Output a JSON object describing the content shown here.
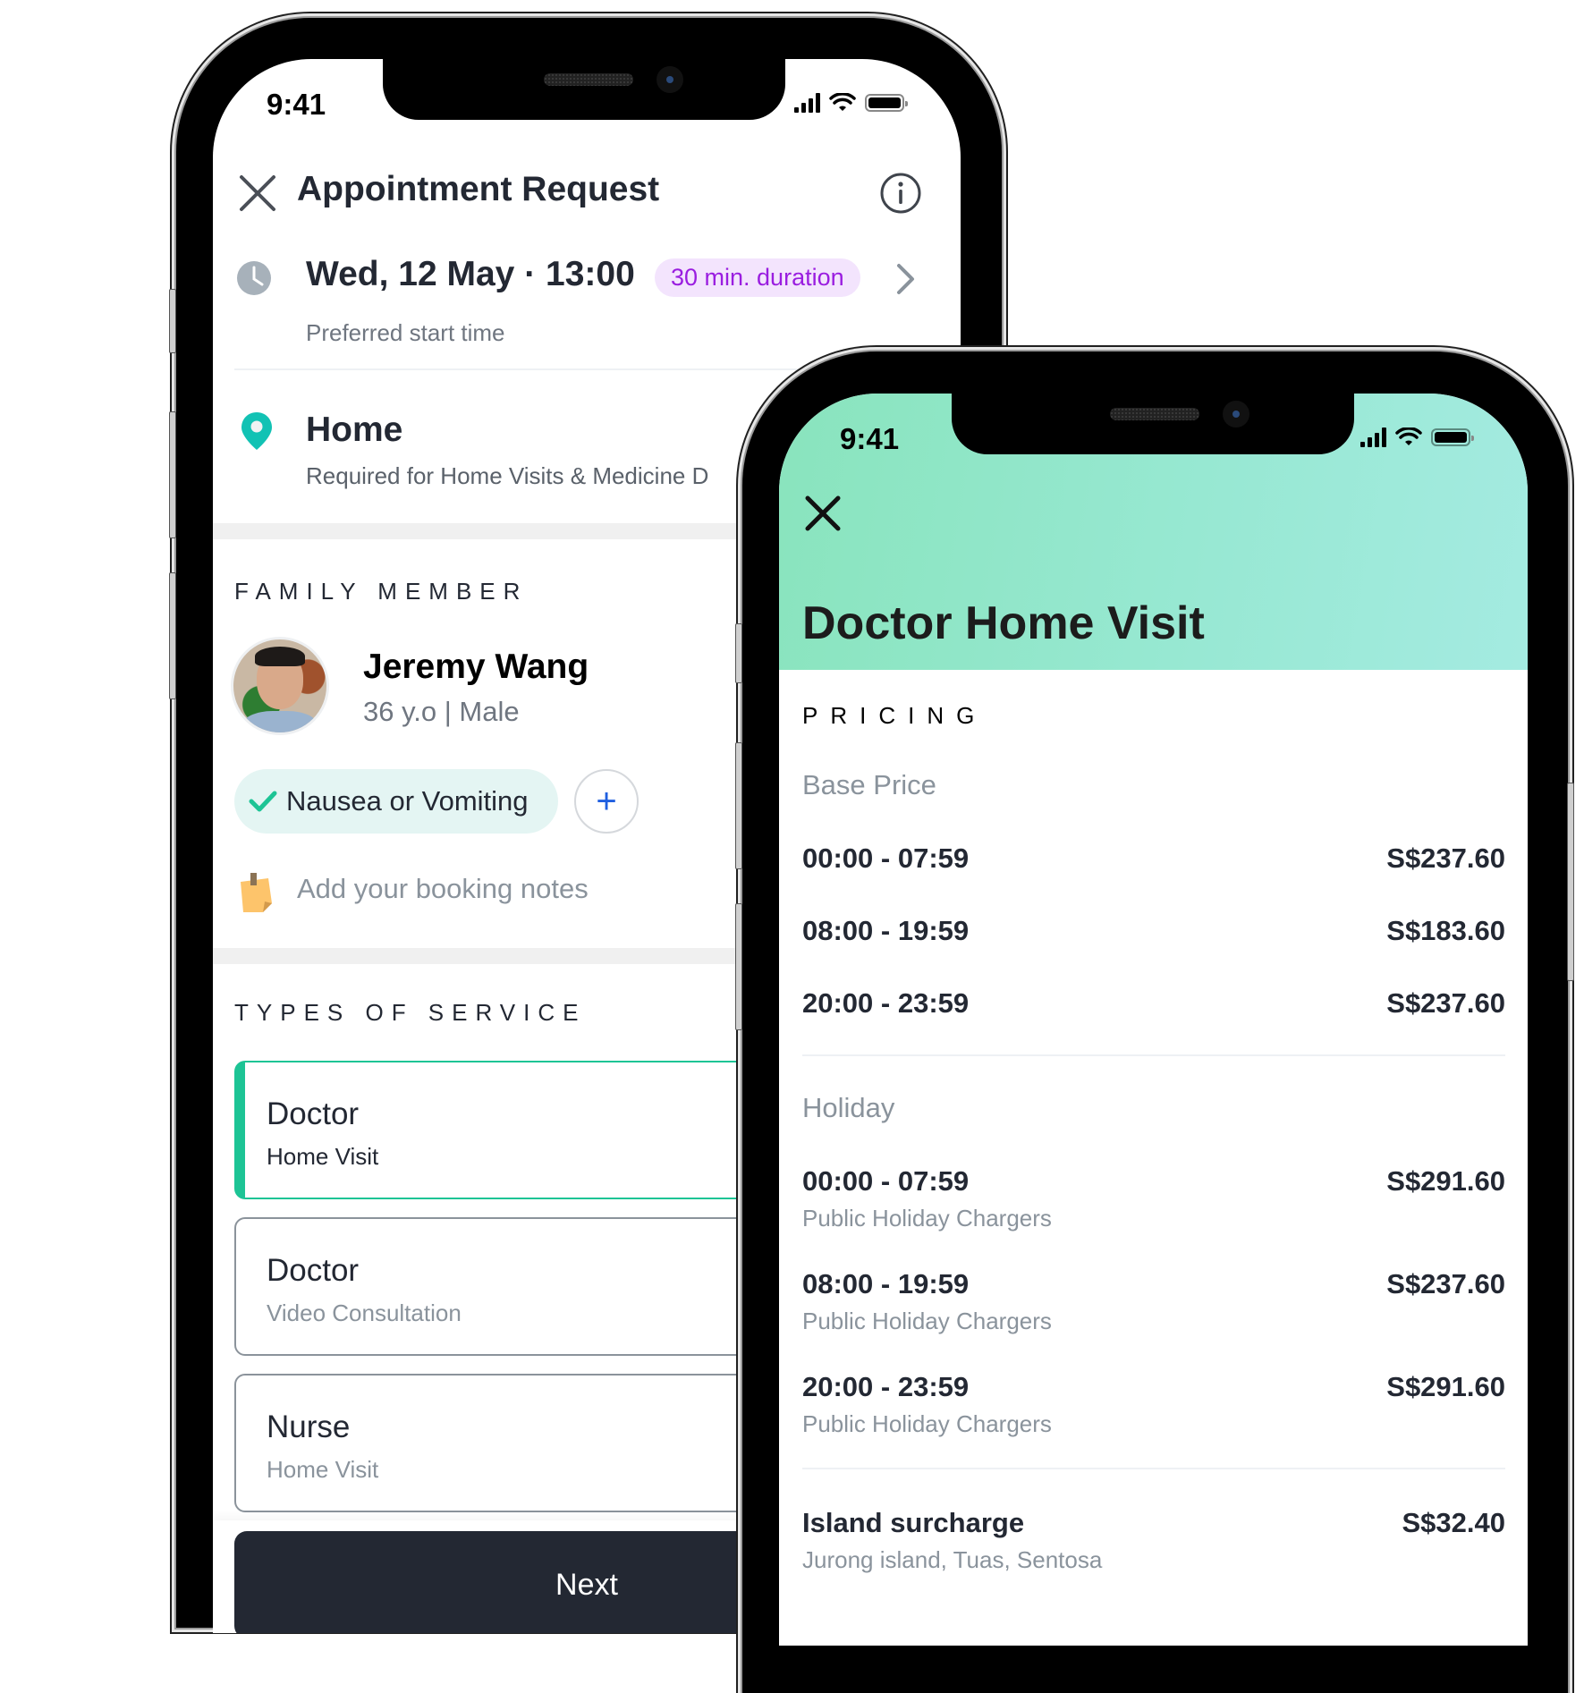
{
  "left_phone": {
    "status_bar": {
      "time": "9:41"
    },
    "header": {
      "title": "Appointment Request",
      "close_icon": "close-icon",
      "info_icon": "info-icon"
    },
    "appointment": {
      "datetime": "Wed, 12 May · 13:00",
      "duration_badge": "30 min. duration",
      "caption": "Preferred start time"
    },
    "location": {
      "name": "Home",
      "caption": "Required for Home Visits & Medicine D"
    },
    "family_member": {
      "section_label": "FAMILY MEMBER",
      "name": "Jeremy Wang",
      "details": "36 y.o | Male",
      "symptoms": [
        {
          "label": "Nausea or Vomiting",
          "selected": true
        }
      ],
      "add_symptom_label": "+"
    },
    "notes": {
      "placeholder": "Add your booking notes"
    },
    "services": {
      "section_label": "TYPES OF SERVICE",
      "items": [
        {
          "title": "Doctor",
          "subtitle": "Home Visit",
          "selected": true
        },
        {
          "title": "Doctor",
          "subtitle": "Video Consultation",
          "selected": false
        },
        {
          "title": "Nurse",
          "subtitle": "Home Visit",
          "selected": false
        }
      ]
    },
    "next_button": "Next",
    "colors": {
      "accent": "#1dc495",
      "badge_text": "#9a1de0",
      "badge_bg": "#f3e4fd",
      "location_pin": "#12c2b4",
      "add_icon": "#1f5fe0",
      "button_bg": "#232833"
    }
  },
  "right_phone": {
    "status_bar": {
      "time": "9:41"
    },
    "header": {
      "title": "Doctor Home Visit",
      "close_icon": "close-icon"
    },
    "pricing": {
      "section_label": "PRICING",
      "base": {
        "label": "Base Price",
        "rows": [
          {
            "range": "00:00 - 07:59",
            "price": "S$237.60"
          },
          {
            "range": "08:00 - 19:59",
            "price": "S$183.60"
          },
          {
            "range": "20:00 - 23:59",
            "price": "S$237.60"
          }
        ]
      },
      "holiday": {
        "label": "Holiday",
        "rows": [
          {
            "range": "00:00 - 07:59",
            "price": "S$291.60",
            "note": "Public Holiday Chargers"
          },
          {
            "range": "08:00 - 19:59",
            "price": "S$237.60",
            "note": "Public Holiday Chargers"
          },
          {
            "range": "20:00 - 23:59",
            "price": "S$291.60",
            "note": "Public Holiday Chargers"
          }
        ]
      },
      "surcharge": {
        "label": "Island surcharge",
        "price": "S$32.40",
        "note": "Jurong island, Tuas, Sentosa"
      }
    },
    "colors": {
      "header_gradient_start": "#89e4bd",
      "header_gradient_end": "#a4ebe1"
    }
  }
}
